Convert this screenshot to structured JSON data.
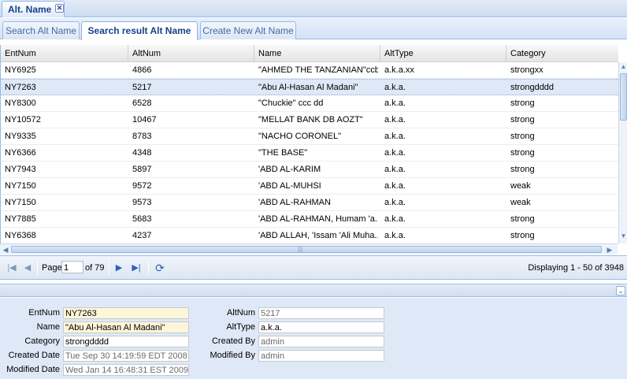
{
  "window_tab": {
    "title": "Alt. Name",
    "close_glyph": "✕"
  },
  "subtabs": [
    {
      "label": "Search Alt Name",
      "active": false
    },
    {
      "label": "Search result Alt Name",
      "active": true
    },
    {
      "label": "Create New Alt Name",
      "active": false
    }
  ],
  "grid": {
    "columns": [
      "EntNum",
      "AltNum",
      "Name",
      "AltType",
      "Category"
    ],
    "rows": [
      [
        "NY6925",
        "4866",
        "\"AHMED THE TANZANIAN\"ccbb",
        "a.k.a.xx",
        "strongxx"
      ],
      [
        "NY7263",
        "5217",
        "\"Abu Al-Hasan Al Madani\"",
        "a.k.a.",
        "strongdddd"
      ],
      [
        "NY8300",
        "6528",
        "\"Chuckie\" ccc dd",
        "a.k.a.",
        "strong"
      ],
      [
        "NY10572",
        "10467",
        "\"MELLAT BANK DB AOZT\"",
        "a.k.a.",
        "strong"
      ],
      [
        "NY9335",
        "8783",
        "\"NACHO CORONEL\"",
        "a.k.a.",
        "strong"
      ],
      [
        "NY6366",
        "4348",
        "\"THE BASE\"",
        "a.k.a.",
        "strong"
      ],
      [
        "NY7943",
        "5897",
        "'ABD AL-KARIM",
        "a.k.a.",
        "strong"
      ],
      [
        "NY7150",
        "9572",
        "'ABD AL-MUHSI",
        "a.k.a.",
        "weak"
      ],
      [
        "NY7150",
        "9573",
        "'ABD AL-RAHMAN",
        "a.k.a.",
        "weak"
      ],
      [
        "NY7885",
        "5683",
        "'ABD AL-RAHMAN, Humam 'a...",
        "a.k.a.",
        "strong"
      ],
      [
        "NY6368",
        "4237",
        "'ABD ALLAH, 'Issam 'Ali Muha...",
        "a.k.a.",
        "strong"
      ]
    ],
    "selected_row": 1
  },
  "pager": {
    "page_label": "Page",
    "page_value": "1",
    "of_label": "of 79",
    "info": "Displaying 1 - 50 of 3948"
  },
  "detail": {
    "labels": {
      "entnum": "EntNum",
      "name": "Name",
      "category": "Category",
      "created_date": "Created Date",
      "modified_date": "Modified Date",
      "altnum": "AltNum",
      "alttype": "AltType",
      "created_by": "Created By",
      "modified_by": "Modified By"
    },
    "values": {
      "entnum": "NY7263",
      "name": "\"Abu Al-Hasan Al Madani\"",
      "category": "strongdddd",
      "created_date": "Tue Sep 30 14:19:59 EDT 2008",
      "modified_date": "Wed Jan 14 16:48:31 EST 2009",
      "altnum": "5217",
      "alttype": "a.k.a.",
      "created_by": "admin",
      "modified_by": "admin"
    }
  },
  "colors": {
    "accent": "#99bbe8",
    "selected_row": "#dfe8f6",
    "form_bg": "#dfe8f6",
    "highlight_field": "#fdf6d8"
  }
}
